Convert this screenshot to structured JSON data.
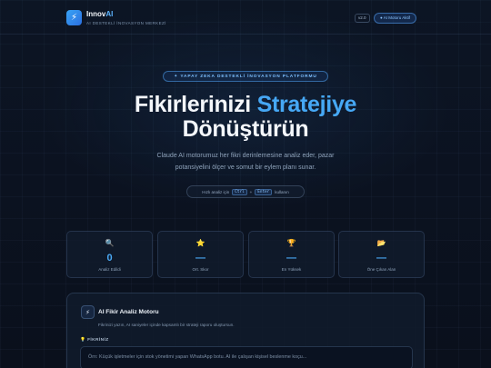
{
  "header": {
    "logo_glyph": "⚡",
    "brand_main": "Innov",
    "brand_accent": "AI",
    "subtitle": "AI DESTEKLİ İNOVASYON MERKEZİ",
    "version": "v2.0",
    "engine_status": "● AI Motoru Aktif"
  },
  "hero": {
    "badge": "✦ YAPAY ZEKA DESTEKLİ İNOVASYON PLATFORMU",
    "title_part1": "Fikirlerinizi",
    "title_accent": "Stratejiye",
    "title_line2": "Dönüştürün",
    "description_line1": "Claude AI motorumuz her fikri derinlemesine analiz eder, pazar",
    "description_line2": "potansiyelini ölçer ve somut bir eylem planı sunar.",
    "hint_prefix": "Hızlı analiz için",
    "hint_key1": "Ctrl",
    "hint_plus": "+",
    "hint_key2": "Enter",
    "hint_suffix": "kullanın"
  },
  "stats": [
    {
      "icon": "search-icon",
      "glyph": "🔍",
      "value": "0",
      "label": "Analiz Edildi"
    },
    {
      "icon": "star-icon",
      "glyph": "⭐",
      "value": "—",
      "label": "Ort. Skor"
    },
    {
      "icon": "trophy-icon",
      "glyph": "🏆",
      "value": "—",
      "label": "En Yüksek"
    },
    {
      "icon": "folder-icon",
      "glyph": "📂",
      "value": "—",
      "label": "Öne Çıkan Alan"
    }
  ],
  "panel": {
    "icon_glyph": "⚡",
    "title": "AI Fikir Analiz Motoru",
    "description": "Fikrinizi yazın, AI saniyeler içinde kapsamlı bir strateji raporu oluştursun.",
    "field_label": "💡 FİKRİNİZ",
    "placeholder": "Örn: Küçük işletmeler için stok yönetimi yapan WhatsApp botu. AI ile çalışan kişisel beslenme koçu..."
  },
  "colors": {
    "accent": "#46a8f5",
    "background": "#0b1220"
  }
}
